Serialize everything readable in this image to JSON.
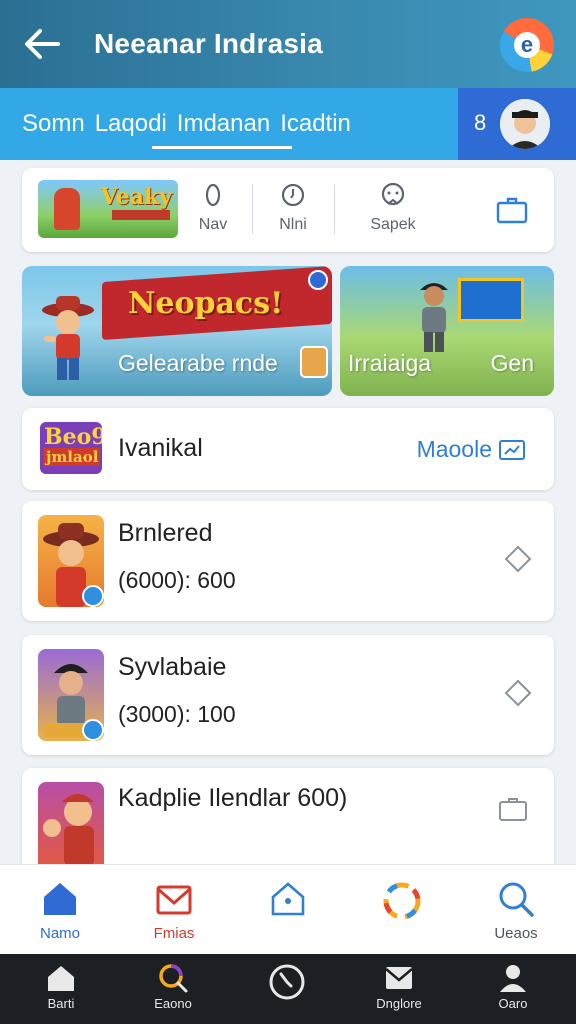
{
  "header": {
    "title": "Neeanar Indrasia",
    "back_icon": "arrow-left-icon",
    "logo_icon": "app-logo-icon",
    "logo_glyph": "e"
  },
  "tabs": {
    "items": [
      {
        "label": "Somn"
      },
      {
        "label": "Laqodi"
      },
      {
        "label": "Imdanan"
      },
      {
        "label": "Icadtin"
      }
    ],
    "active_index": 2,
    "notification_count": "8"
  },
  "quick_actions": {
    "thumb_text": "Veaky",
    "items": [
      {
        "label": "Nav",
        "icon": "zero-icon"
      },
      {
        "label": "Nlni",
        "icon": "clock-icon"
      },
      {
        "label": "Sapek",
        "icon": "smiley-icon"
      }
    ],
    "right_icon": "briefcase-icon"
  },
  "banners": [
    {
      "ribbon": "Neopacs!",
      "caption": "Gelearabe rnde"
    },
    {
      "left": "Irraiaiga",
      "right": "Gen"
    }
  ],
  "section": {
    "logo_line1": "Beo9",
    "logo_line2": "jmlaol",
    "title": "Ivanikal",
    "link": "Maoole",
    "link_icon": "image-icon"
  },
  "list": [
    {
      "name": "Brnlered",
      "subtitle": "(6000): 600",
      "action_icon": "diamond-icon"
    },
    {
      "name": "Syvlabaie",
      "subtitle": "(3000): 100",
      "action_icon": "diamond-icon"
    },
    {
      "name": "Kadplie Ilendlar 600)",
      "action_icon": "briefcase-icon"
    }
  ],
  "app_nav": [
    {
      "label": "Namo",
      "icon": "home-icon",
      "color": "#2f6bd4"
    },
    {
      "label": "Fmias",
      "icon": "mail-icon",
      "color": "#d63a2d"
    },
    {
      "label": "",
      "icon": "house-outline-icon"
    },
    {
      "label": "",
      "icon": "spinner-icon"
    },
    {
      "label": "Ueaos",
      "icon": "search-icon"
    }
  ],
  "system_nav": [
    {
      "label": "Barti",
      "icon": "home-icon"
    },
    {
      "label": "Eaono",
      "icon": "search-icon"
    },
    {
      "label": "",
      "icon": "clock-icon"
    },
    {
      "label": "Dnglore",
      "icon": "mail-icon"
    },
    {
      "label": "Oaro",
      "icon": "person-icon"
    }
  ],
  "colors": {
    "header": "#2b6f93",
    "tab_strip": "#32a8e6",
    "profile_box": "#2f6bd4",
    "accent_blue": "#2f6bd4",
    "accent_red": "#d63a2d",
    "system_nav": "#1c1f24"
  }
}
